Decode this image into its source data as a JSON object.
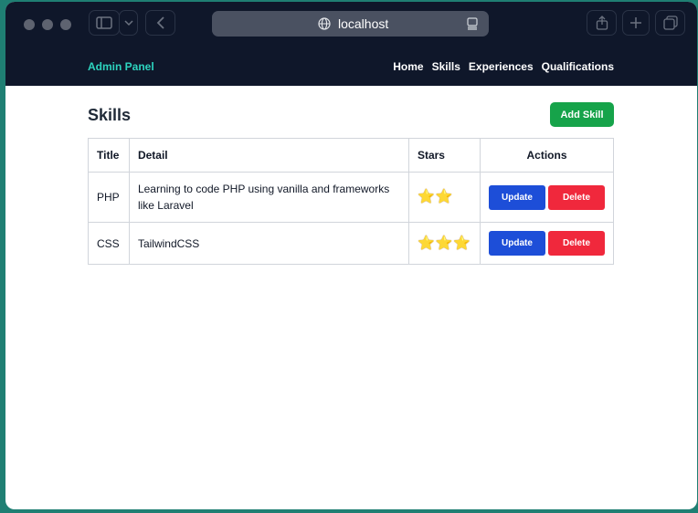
{
  "browser": {
    "url": "localhost"
  },
  "navbar": {
    "brand": "Admin Panel",
    "links": [
      "Home",
      "Skills",
      "Experiences",
      "Qualifications"
    ]
  },
  "page": {
    "title": "Skills",
    "add_button": "Add Skill"
  },
  "table": {
    "headers": [
      "Title",
      "Detail",
      "Stars",
      "Actions"
    ],
    "rows": [
      {
        "title": "PHP",
        "detail": "Learning to code PHP using vanilla and frameworks like Laravel",
        "stars": 2,
        "stars_text": "⭐⭐",
        "update": "Update",
        "delete": "Delete"
      },
      {
        "title": "CSS",
        "detail": "TailwindCSS",
        "stars": 3,
        "stars_text": "⭐⭐⭐",
        "update": "Update",
        "delete": "Delete"
      }
    ]
  },
  "colors": {
    "navbar_bg": "#0f172a",
    "brand": "#2dd4bf",
    "add_button": "#16a34a",
    "update_button": "#1d4ed8",
    "delete_button": "#f0283c"
  }
}
